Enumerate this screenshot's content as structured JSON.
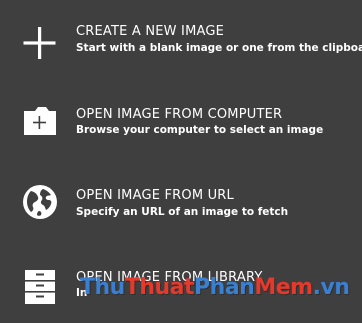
{
  "menu": {
    "items": [
      {
        "title": "CREATE A NEW IMAGE",
        "subtitle": "Start with a blank image or one from the clipboard",
        "icon": "plus-icon"
      },
      {
        "title": "OPEN IMAGE FROM COMPUTER",
        "subtitle": "Browse your computer to select an image",
        "icon": "folder-plus-icon"
      },
      {
        "title": "OPEN IMAGE FROM URL",
        "subtitle": "Specify an URL of an image to fetch",
        "icon": "globe-icon"
      },
      {
        "title": "OPEN IMAGE FROM LIBRARY",
        "subtitle": "In",
        "icon": "cabinet-icon"
      }
    ]
  },
  "watermark": {
    "parts": [
      "Thu",
      "Thuat",
      "Phan",
      "Mem",
      ".vn"
    ],
    "colors": [
      "#3a7fd0",
      "#e5392b",
      "#3a7fd0",
      "#e5392b",
      "#3a7fd0"
    ]
  },
  "colors": {
    "background": "#3f3f3f",
    "text": "#ffffff"
  }
}
